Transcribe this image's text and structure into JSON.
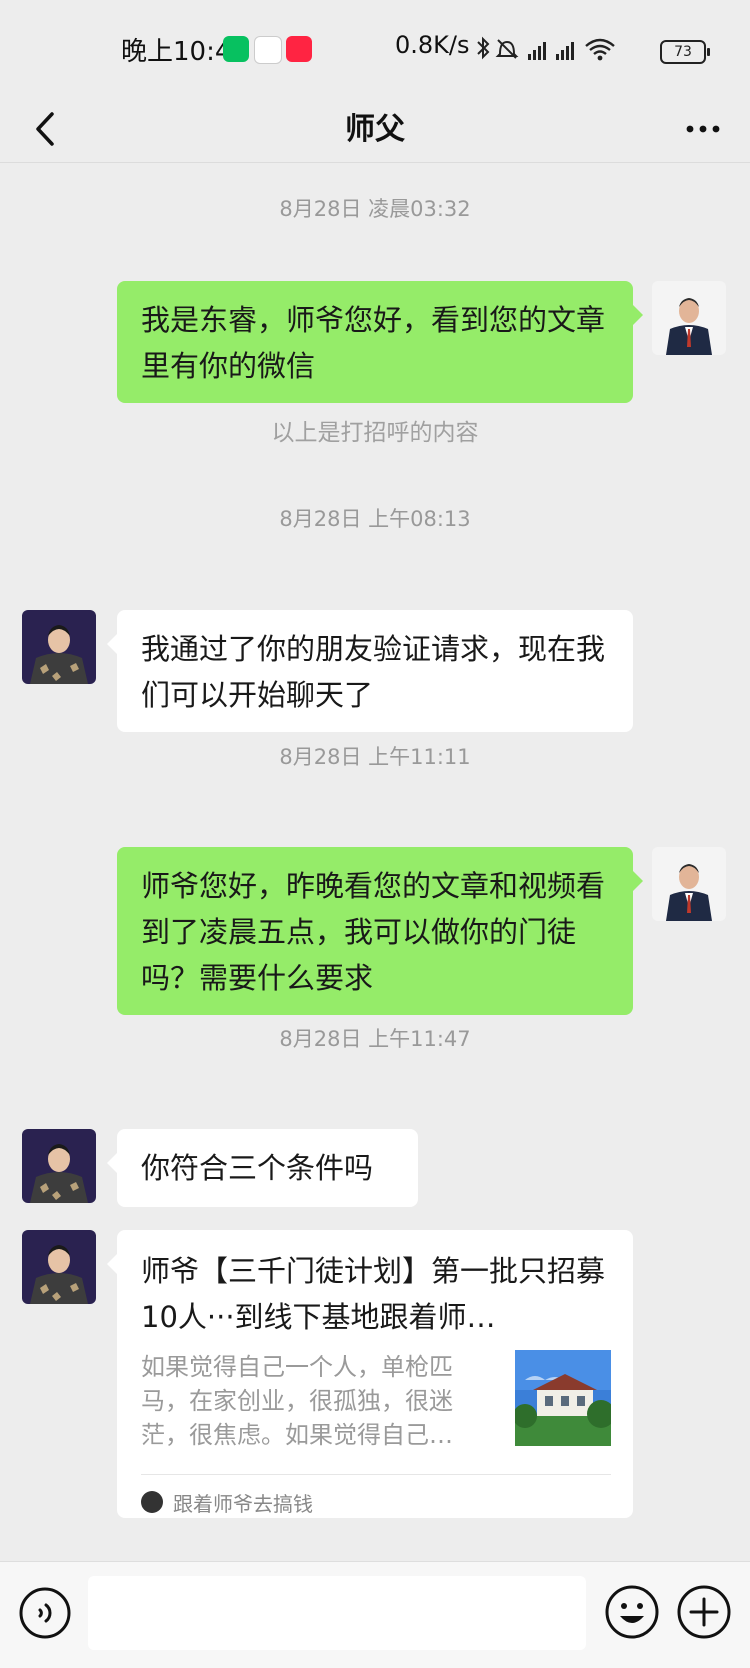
{
  "status_bar": {
    "time": "晚上10:46",
    "network_speed": "0.8K/s",
    "battery": "73"
  },
  "header": {
    "title": "师父"
  },
  "messages": [
    {
      "type": "time",
      "text": "8月28日 凌晨03:32"
    },
    {
      "type": "outgoing",
      "text": "我是东睿，师爷您好，看到您的文章里有你的微信"
    },
    {
      "type": "hint",
      "text": "以上是打招呼的内容"
    },
    {
      "type": "time",
      "text": "8月28日 上午08:13"
    },
    {
      "type": "incoming",
      "text": "我通过了你的朋友验证请求，现在我们可以开始聊天了"
    },
    {
      "type": "time",
      "text": "8月28日 上午11:11"
    },
    {
      "type": "outgoing",
      "text": "师爷您好，昨晚看您的文章和视频看到了凌晨五点，我可以做你的门徒吗？需要什么要求"
    },
    {
      "type": "time",
      "text": "8月28日 上午11:47"
    },
    {
      "type": "incoming",
      "text": "你符合三个条件吗"
    },
    {
      "type": "article_card",
      "title": "师爷【三千门徒计划】第一批只招募10人···到线下基地跟着师…",
      "description": "如果觉得自己一个人，单枪匹马，在家创业，很孤独，很迷茫，很焦虑。如果觉得自己…",
      "source": "跟着师爷去搞钱"
    }
  ],
  "input_bar": {
    "placeholder": ""
  },
  "colors": {
    "background": "#ededed",
    "outgoing_bubble": "#95ec69",
    "incoming_bubble": "#ffffff"
  },
  "icons": [
    "back-arrow-icon",
    "more-icon",
    "voice-icon",
    "emoji-icon",
    "plus-icon"
  ]
}
